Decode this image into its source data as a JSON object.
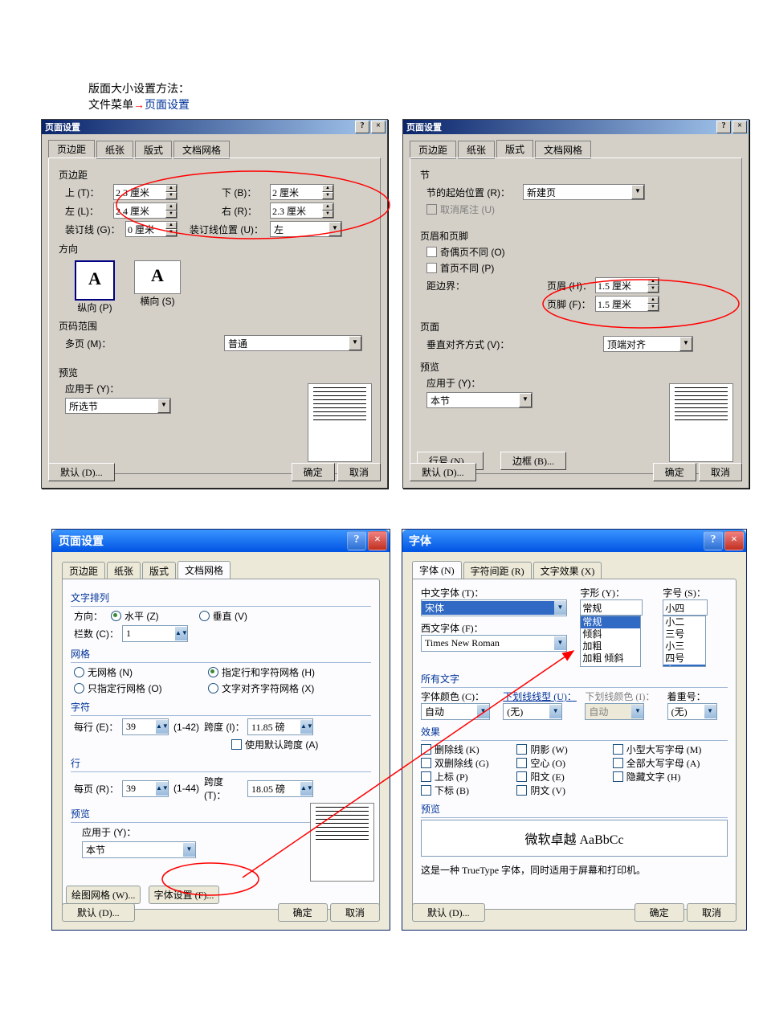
{
  "intro": {
    "line1": "版面大小设置方法：",
    "line2a": "文件菜单",
    "arrow": "→",
    "line2b": "页面设置"
  },
  "dlg1": {
    "title": "页面设置",
    "tabs": {
      "margins": "页边距",
      "paper": "纸张",
      "layout": "版式",
      "grid": "文档网格"
    },
    "margins_grp": "页边距",
    "top_lbl": "上 (T)：",
    "top_val": "2.3 厘米",
    "bottom_lbl": "下 (B)：",
    "bottom_val": "2 厘米",
    "left_lbl": "左 (L)：",
    "left_val": "2.4 厘米",
    "right_lbl": "右 (R)：",
    "right_val": "2.3 厘米",
    "gutter_lbl": "装订线 (G)：",
    "gutter_val": "0 厘米",
    "gutterpos_lbl": "装订线位置 (U)：",
    "gutterpos_val": "左",
    "orient_grp": "方向",
    "portrait": "纵向 (P)",
    "landscape": "横向 (S)",
    "pages_grp": "页码范围",
    "multi_lbl": "多页 (M)：",
    "multi_val": "普通",
    "preview_grp": "预览",
    "applyto_lbl": "应用于 (Y)：",
    "applyto_val": "所选节",
    "default_btn": "默认 (D)...",
    "ok": "确定",
    "cancel": "取消"
  },
  "dlg2": {
    "title": "页面设置",
    "tabs": {
      "margins": "页边距",
      "paper": "纸张",
      "layout": "版式",
      "grid": "文档网格"
    },
    "section_grp": "节",
    "secstart_lbl": "节的起始位置 (R)：",
    "secstart_val": "新建页",
    "suppress_lbl": "取消尾注 (U)",
    "hf_grp": "页眉和页脚",
    "oddeven_lbl": "奇偶页不同 (O)",
    "firstpg_lbl": "首页不同 (P)",
    "fromedge_lbl": "距边界：",
    "header_lbl": "页眉 (H)：",
    "header_val": "1.5 厘米",
    "footer_lbl": "页脚 (F)：",
    "footer_val": "1.5 厘米",
    "page_grp": "页面",
    "valign_lbl": "垂直对齐方式 (V)：",
    "valign_val": "顶端对齐",
    "preview_grp": "预览",
    "applyto_lbl": "应用于 (Y)：",
    "applyto_val": "本节",
    "linenum_btn": "行号 (N)...",
    "border_btn": "边框 (B)...",
    "default_btn": "默认 (D)...",
    "ok": "确定",
    "cancel": "取消"
  },
  "dlg3": {
    "title": "页面设置",
    "tabs": {
      "margins": "页边距",
      "paper": "纸张",
      "layout": "版式",
      "grid": "文档网格"
    },
    "textflow_grp": "文字排列",
    "dir_lbl": "方向：",
    "horiz": "水平 (Z)",
    "vert": "垂直 (V)",
    "cols_lbl": "栏数 (C)：",
    "cols_val": "1",
    "grid_grp": "网格",
    "nogrid": "无网格 (N)",
    "linechar": "指定行和字符网格 (H)",
    "lineonly": "只指定行网格 (O)",
    "charalign": "文字对齐字符网格 (X)",
    "char_grp": "字符",
    "perline_lbl": "每行 (E)：",
    "perline_val": "39",
    "perline_rng": "(1-42)",
    "pitch_lbl": "跨度 (I)：",
    "pitch_val": "11.85 磅",
    "usedefpitch": "使用默认跨度 (A)",
    "line_grp": "行",
    "perpage_lbl": "每页 (R)：",
    "perpage_val": "39",
    "perpage_rng": "(1-44)",
    "linepitch_lbl": "跨度 (T)：",
    "linepitch_val": "18.05 磅",
    "preview_grp": "预览",
    "applyto_lbl": "应用于 (Y)：",
    "applyto_val": "本节",
    "drawgrid_btn": "绘图网格 (W)...",
    "fontset_btn": "字体设置 (F)...",
    "default_btn": "默认 (D)...",
    "ok": "确定",
    "cancel": "取消"
  },
  "dlg4": {
    "title": "字体",
    "tabs": {
      "font": "字体 (N)",
      "spacing": "字符间距 (R)",
      "texteff": "文字效果 (X)"
    },
    "cnfont_lbl": "中文字体 (T)：",
    "cnfont_val": "宋体",
    "westfont_lbl": "西文字体 (F)：",
    "westfont_val": "Times New Roman",
    "style_lbl": "字形 (Y)：",
    "style_val": "常规",
    "style_opts": [
      "常规",
      "倾斜",
      "加粗",
      "加粗 倾斜"
    ],
    "size_lbl": "字号 (S)：",
    "size_val": "小四",
    "size_opts": [
      "小二",
      "三号",
      "小三",
      "四号",
      "小四"
    ],
    "alltext_grp": "所有文字",
    "fontcolor_lbl": "字体颜色 (C)：",
    "fontcolor_val": "自动",
    "underline_lbl": "下划线线型 (U)：",
    "underline_val": "(无)",
    "ulcolor_lbl": "下划线颜色 (I)：",
    "ulcolor_val": "自动",
    "emphasis_lbl": "着重号：",
    "emphasis_val": "(无)",
    "effects_grp": "效果",
    "eff": {
      "strike": "删除线 (K)",
      "dstrike": "双删除线 (G)",
      "sup": "上标 (P)",
      "sub": "下标 (B)",
      "shadow": "阴影 (W)",
      "outline": "空心 (O)",
      "emboss": "阳文 (E)",
      "engrave": "阴文 (V)",
      "smallcaps": "小型大写字母 (M)",
      "allcaps": "全部大写字母 (A)",
      "hidden": "隐藏文字 (H)"
    },
    "preview_grp": "预览",
    "preview_text": "微软卓越 AaBbCc",
    "tt_note": "这是一种 TrueType 字体，同时适用于屏幕和打印机。",
    "default_btn": "默认 (D)...",
    "ok": "确定",
    "cancel": "取消"
  }
}
